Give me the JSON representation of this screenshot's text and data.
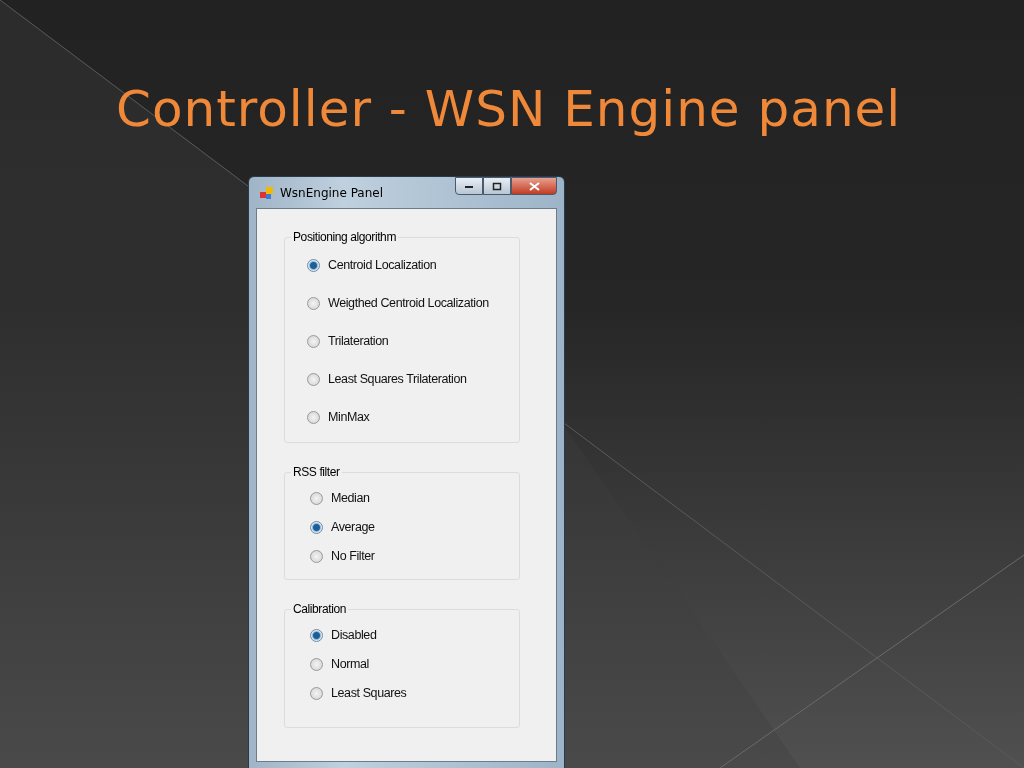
{
  "slide": {
    "title": "Controller - WSN Engine panel"
  },
  "window": {
    "title": "WsnEngine Panel"
  },
  "groups": [
    {
      "label": "Positioning algorithm",
      "options": [
        {
          "label": "Centroid Localization",
          "selected": true
        },
        {
          "label": "Weigthed Centroid Localization",
          "selected": false
        },
        {
          "label": "Trilateration",
          "selected": false
        },
        {
          "label": "Least Squares Trilateration",
          "selected": false
        },
        {
          "label": "MinMax",
          "selected": false
        }
      ]
    },
    {
      "label": "RSS filter",
      "options": [
        {
          "label": "Median",
          "selected": false
        },
        {
          "label": "Average",
          "selected": true
        },
        {
          "label": "No Filter",
          "selected": false
        }
      ]
    },
    {
      "label": "Calibration",
      "options": [
        {
          "label": "Disabled",
          "selected": true
        },
        {
          "label": "Normal",
          "selected": false
        },
        {
          "label": "Least Squares",
          "selected": false
        }
      ]
    }
  ]
}
